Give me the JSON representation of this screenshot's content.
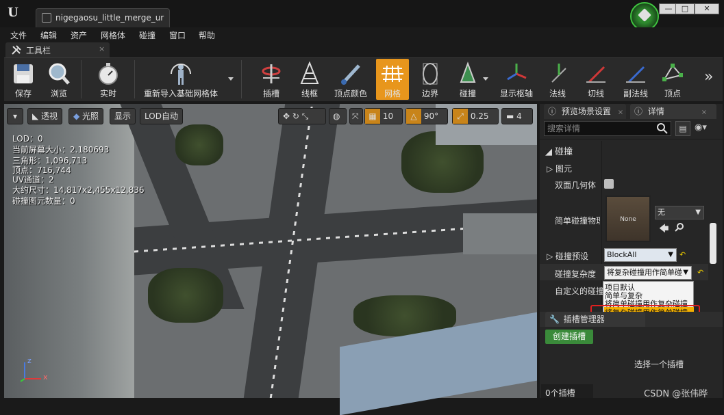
{
  "window": {
    "tab_title": "nigegaosu_little_merge_ur",
    "min_label": "—",
    "max_label": "□",
    "close_label": "✕"
  },
  "menu": [
    "文件",
    "编辑",
    "资产",
    "网格体",
    "碰撞",
    "窗口",
    "帮助"
  ],
  "toolbar_tab": {
    "label": "工具栏",
    "close": "×"
  },
  "toolbar": {
    "save": "保存",
    "browse": "浏览",
    "realtime": "实时",
    "reimport": "重新导入基础网格体",
    "sockets": "插槽",
    "wireframe": "线框",
    "vertex_color": "顶点颜色",
    "grid": "网格",
    "bounds": "边界",
    "collision": "碰撞",
    "pivot": "显示枢轴",
    "normals": "法线",
    "tangents": "切线",
    "binormals": "副法线",
    "vertices": "顶点",
    "more": "»"
  },
  "viewport": {
    "perspective": "透视",
    "lit": "光照",
    "show": "显示",
    "lod": "LOD自动",
    "grid_snap": "10",
    "rot_snap": "90°",
    "scale_snap": "0.25",
    "cam_speed": "4",
    "stats": [
      "LOD：0",
      "当前屏幕大小：2.180693",
      "三角形：1,096,713",
      "顶点：716,744",
      "UV通道：2",
      "大约尺寸：14,817x2,455x12,836",
      "碰撞图元数量：0"
    ],
    "axis_z": "z",
    "axis_x": "x"
  },
  "panel": {
    "tab_preview": "预览场景设置",
    "tab_details": "详情",
    "search_placeholder": "搜索详情",
    "section": "碰撞",
    "primitives": "图元",
    "double_sided": "双面几何体",
    "simple_physmat": "简单碰撞物理材",
    "thumb_label": "None",
    "phys_value": "无",
    "preset_label": "碰撞预设",
    "preset_value": "BlockAll",
    "complexity_label": "碰撞复杂度",
    "complexity_value": "将复杂碰撞用作简单碰",
    "custom_label": "自定义的碰撞",
    "options": [
      "项目默认",
      "简单与复杂",
      "将简单碰撞用作复杂碰撞",
      "将复杂碰撞用作简单碰撞"
    ],
    "sockets_title": "插槽管理器",
    "create_socket": "创建插槽",
    "select_socket": "选择一个插槽",
    "socket_count": "0个插槽",
    "watermark": "CSDN @张伟晔"
  }
}
